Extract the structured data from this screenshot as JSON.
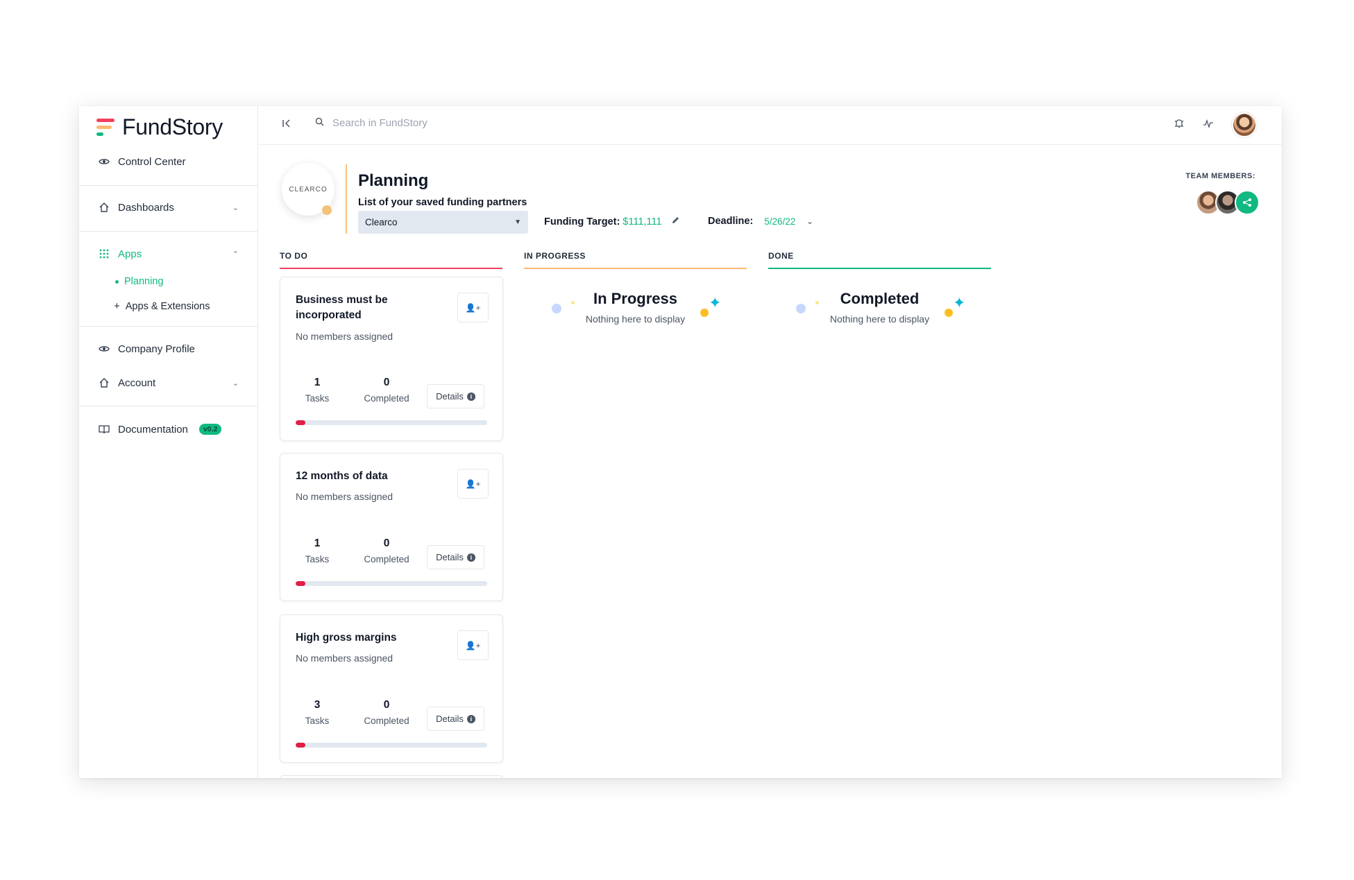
{
  "app": {
    "name": "FundStory"
  },
  "sidebar": {
    "items": [
      {
        "label": "Control Center"
      },
      {
        "label": "Dashboards"
      },
      {
        "label": "Apps"
      },
      {
        "label": "Planning"
      },
      {
        "label": "Apps & Extensions"
      },
      {
        "label": "Company Profile"
      },
      {
        "label": "Account"
      },
      {
        "label": "Documentation",
        "badge": "v0.2"
      }
    ]
  },
  "topbar": {
    "search_placeholder": "Search in FundStory"
  },
  "header": {
    "brand_logo_text": "CLEARCO",
    "title": "Planning",
    "subtitle": "List of your saved funding partners",
    "partner_selected": "Clearco",
    "funding_label": "Funding Target:",
    "funding_value": "$111,111",
    "deadline_label": "Deadline:",
    "deadline_value": "5/26/22",
    "team_label": "TEAM MEMBERS:"
  },
  "columns": [
    {
      "title": "TO DO",
      "color": "#f43f5e"
    },
    {
      "title": "IN PROGRESS",
      "color": "#fdba74",
      "empty_title": "In Progress",
      "empty_text": "Nothing here to display"
    },
    {
      "title": "DONE",
      "color": "#10b981",
      "empty_title": "Completed",
      "empty_text": "Nothing here to display"
    }
  ],
  "cards": [
    {
      "title": "Business must be incorporated",
      "members": "No members assigned",
      "tasks": "1",
      "tasks_label": "Tasks",
      "completed": "0",
      "completed_label": "Completed",
      "details": "Details",
      "progress": 0.05
    },
    {
      "title": "12 months of data",
      "members": "No members assigned",
      "tasks": "1",
      "tasks_label": "Tasks",
      "completed": "0",
      "completed_label": "Completed",
      "details": "Details",
      "progress": 0.05
    },
    {
      "title": "High gross margins",
      "members": "No members assigned",
      "tasks": "3",
      "tasks_label": "Tasks",
      "completed": "0",
      "completed_label": "Completed",
      "details": "Details",
      "progress": 0.05
    }
  ],
  "colors": {
    "accent": "#10b981",
    "progress": "#e11d48",
    "logo_pink": "#f43f5e",
    "logo_orange": "#fdba74",
    "logo_green": "#10b981"
  }
}
